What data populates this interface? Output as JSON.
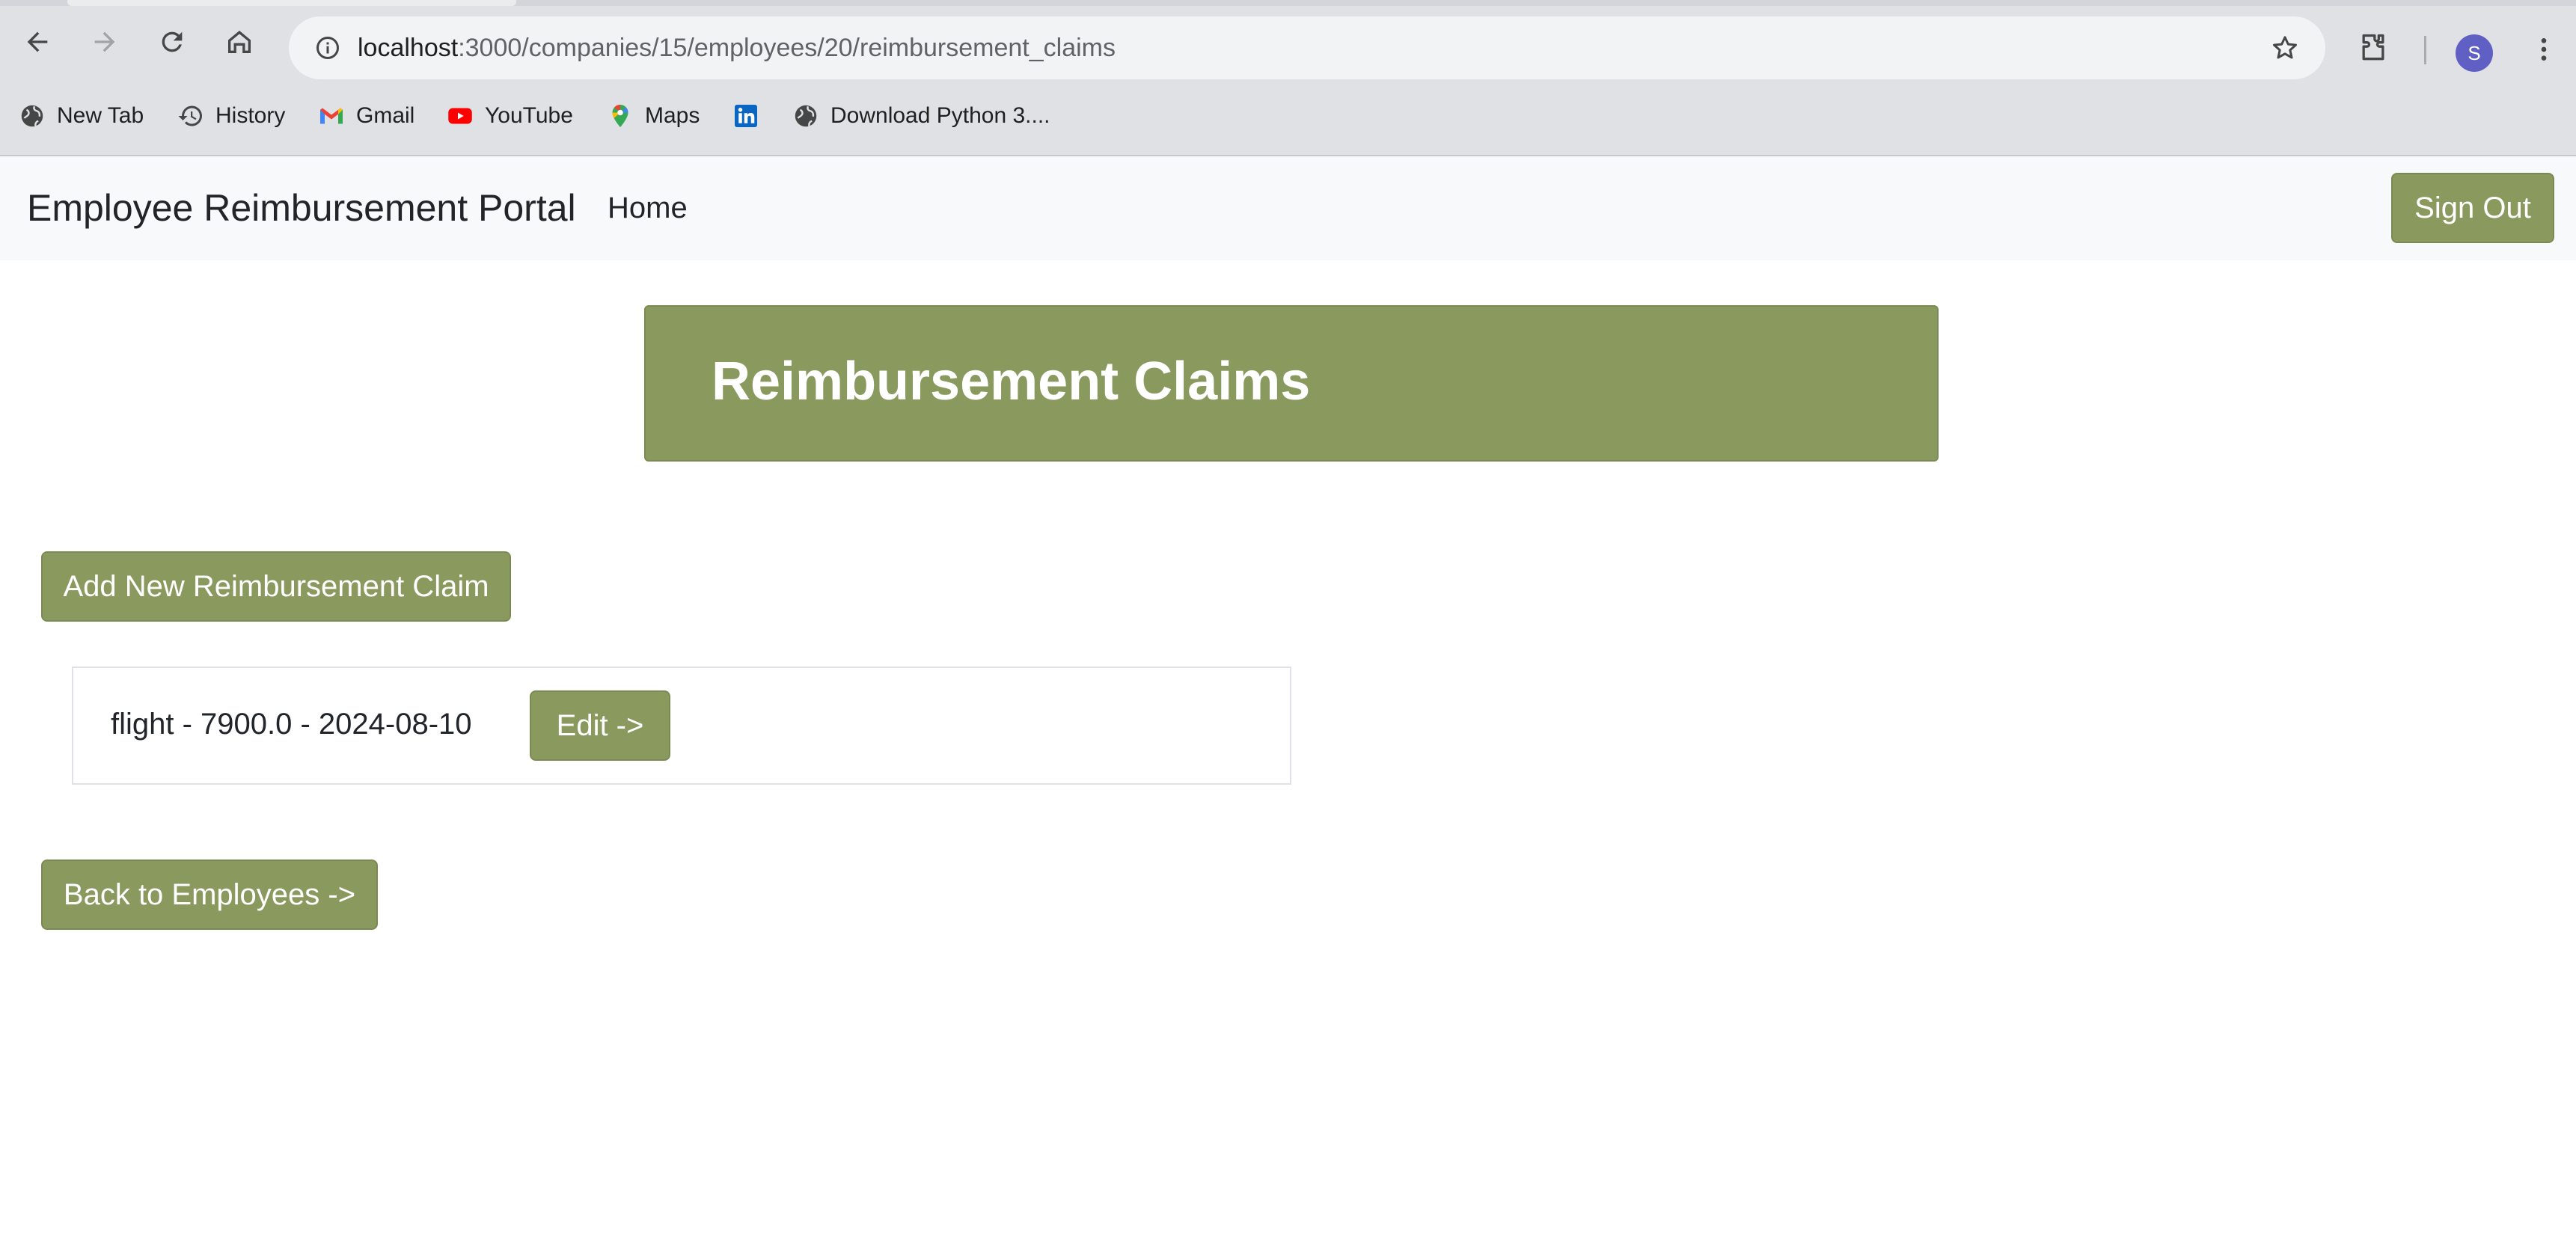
{
  "browser": {
    "url_host": "localhost",
    "url_path": ":3000/companies/15/employees/20/reimbursement_claims",
    "profile_initial": "S",
    "bookmarks": [
      {
        "label": "New Tab",
        "icon": "globe-icon"
      },
      {
        "label": "History",
        "icon": "history-icon"
      },
      {
        "label": "Gmail",
        "icon": "gmail-icon"
      },
      {
        "label": "YouTube",
        "icon": "youtube-icon"
      },
      {
        "label": "Maps",
        "icon": "maps-icon"
      },
      {
        "label": "",
        "icon": "linkedin-icon"
      },
      {
        "label": "Download Python 3....",
        "icon": "globe-icon"
      }
    ]
  },
  "navbar": {
    "brand": "Employee Reimbursement Portal",
    "home": "Home",
    "sign_out": "Sign Out"
  },
  "page": {
    "title": "Reimbursement Claims",
    "add_button": "Add New Reimbursement Claim",
    "claims": [
      {
        "text": "flight - 7900.0 - 2024-08-10",
        "edit_label": "Edit ->"
      }
    ],
    "back_button": "Back to Employees ->"
  },
  "colors": {
    "accent": "#8a9a5f",
    "navbar_bg": "#f8f9fa",
    "chrome_bg": "#dfe1e5"
  }
}
